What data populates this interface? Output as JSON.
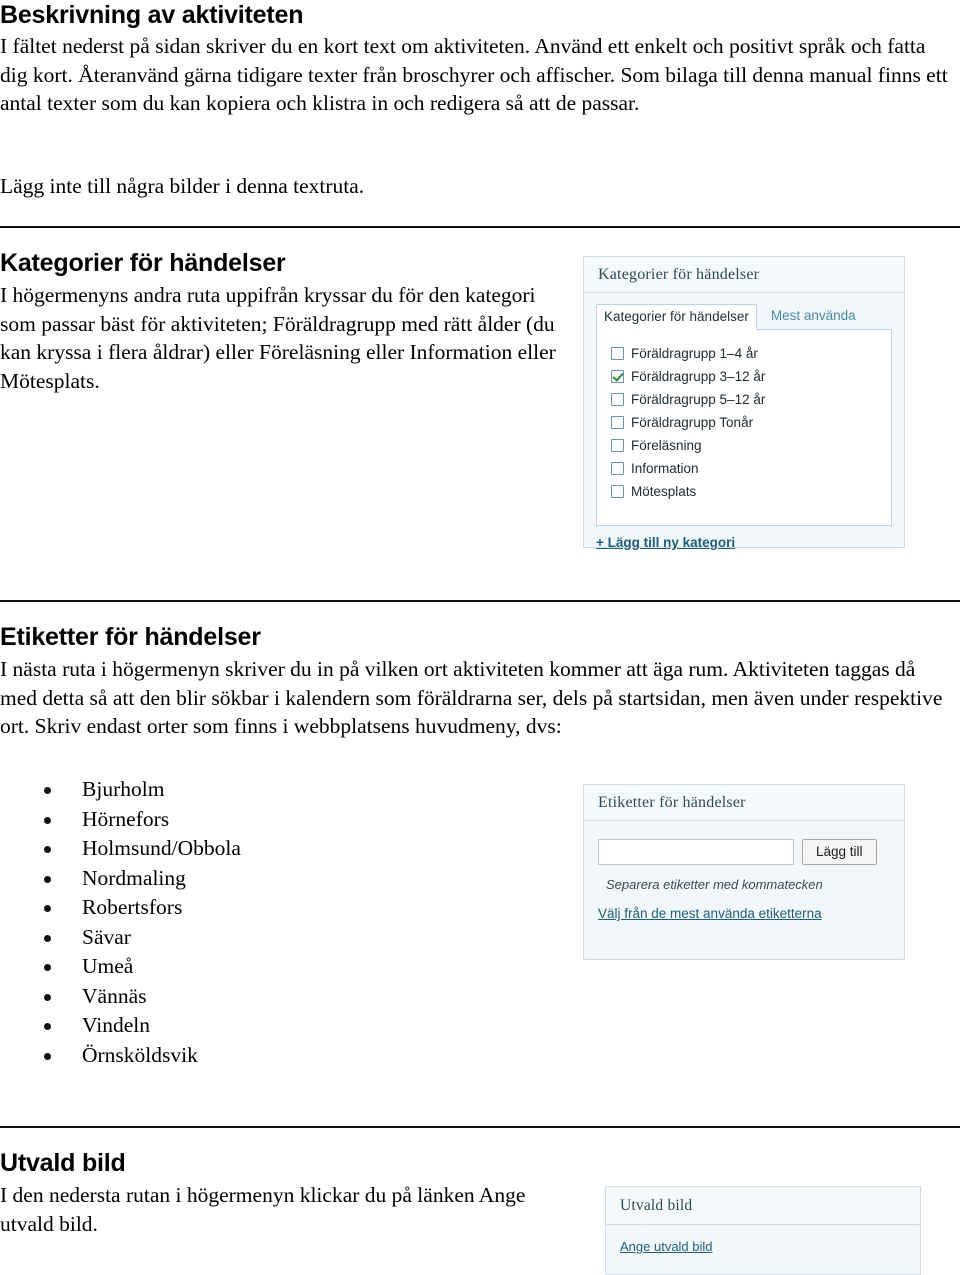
{
  "sections": {
    "beskrivning": {
      "heading": "Beskrivning av aktiviteten",
      "body": "I fältet nederst på sidan skriver du en kort text om aktiviteten. Använd ett enkelt och positivt språk och fatta dig kort. Återanvänd gärna tidigare texter från broschyrer och affischer. Som bilaga till denna manual finns ett antal texter som du kan kopiera och klistra in och redigera så att de passar.",
      "note": "Lägg inte till några bilder i denna textruta."
    },
    "kategorier": {
      "heading": "Kategorier för händelser",
      "body": "I högermenyns andra ruta uppifrån kryssar du för den kategori som passar bäst för aktiviteten; Föräldragrupp med rätt ålder (du kan kryssa i flera åldrar) eller Föreläsning eller Information eller Mötesplats."
    },
    "etiketter": {
      "heading": "Etiketter för händelser",
      "body": "I nästa ruta i högermenyn skriver du in på vilken ort aktiviteten kommer att äga rum. Aktiviteten taggas då med detta så att den blir sökbar i kalendern som föräldrarna ser, dels på startsidan, men även under respektive ort. Skriv endast orter som finns i webbplatsens huvudmeny, dvs:",
      "cities": [
        "Bjurholm",
        "Hörnefors",
        "Holmsund/Obbola",
        "Nordmaling",
        "Robertsfors",
        "Sävar",
        "Umeå",
        "Vännäs",
        "Vindeln",
        "Örnsköldsvik"
      ]
    },
    "utvald_bild": {
      "heading": "Utvald bild",
      "body": "I den nedersta rutan i högermenyn klickar du på länken Ange utvald bild."
    }
  },
  "widgets": {
    "kategorier_widget": {
      "title": "Kategorier för händelser",
      "tabs": [
        {
          "label": "Kategorier för händelser",
          "active": true
        },
        {
          "label": "Mest använda",
          "active": false
        }
      ],
      "checkboxes": [
        {
          "label": "Föräldragrupp 1–4 år",
          "checked": false
        },
        {
          "label": "Föräldragrupp 3–12 år",
          "checked": true
        },
        {
          "label": "Föräldragrupp 5–12 år",
          "checked": false
        },
        {
          "label": "Föräldragrupp Tonår",
          "checked": false
        },
        {
          "label": "Föreläsning",
          "checked": false
        },
        {
          "label": "Information",
          "checked": false
        },
        {
          "label": "Mötesplats",
          "checked": false
        }
      ],
      "add_link": "+ Lägg till ny kategori"
    },
    "etiketter_widget": {
      "title": "Etiketter för händelser",
      "input_value": "",
      "input_placeholder": "",
      "add_button": "Lägg till",
      "hint": "Separera etiketter med kommatecken",
      "choose_link": "Välj från de mest använda etiketterna"
    },
    "utvald_widget": {
      "title": "Utvald bild",
      "link": "Ange utvald bild"
    }
  },
  "colors": {
    "widget_bg": "#f2f7fb",
    "widget_border": "#cfdde8",
    "link": "#1f5f77",
    "tab_inactive": "#4b8ba3",
    "check_green": "#2d8a32",
    "rule": "#101010"
  }
}
